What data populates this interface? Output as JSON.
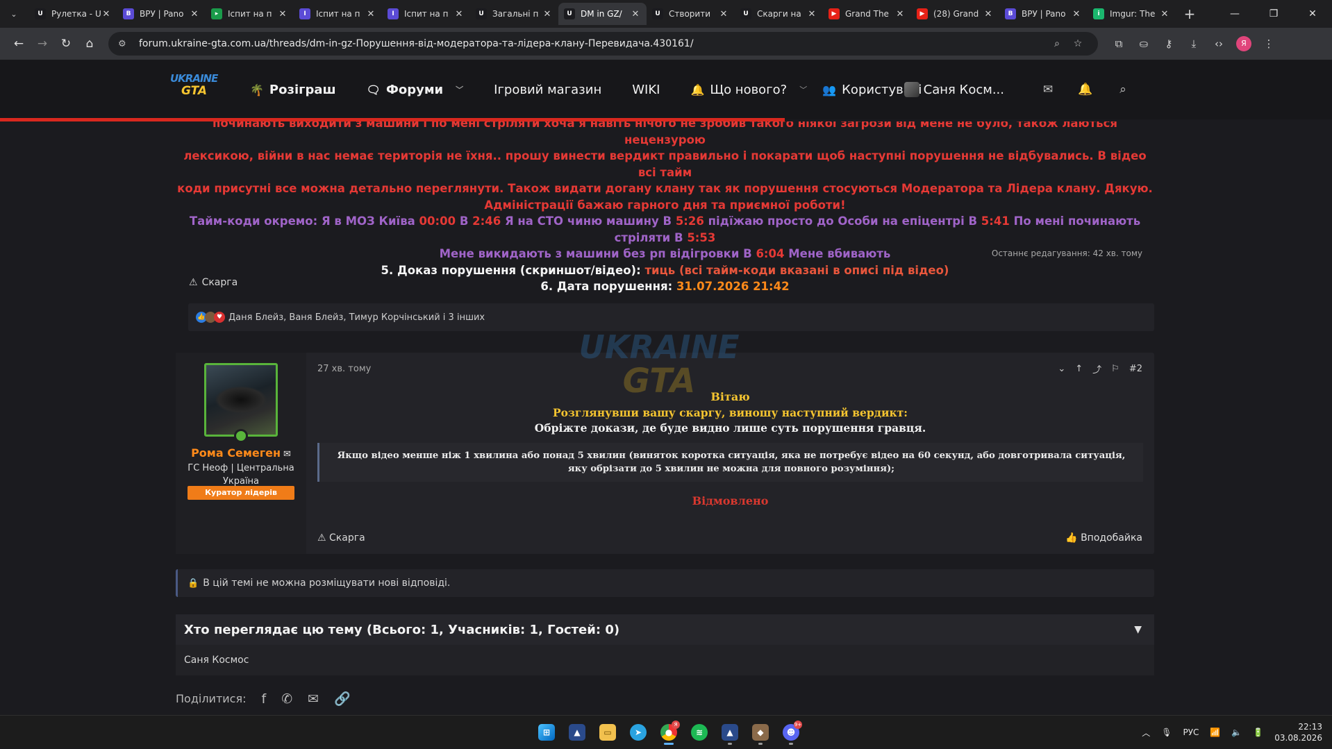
{
  "browser": {
    "tabs": [
      {
        "title": "Рулетка - U",
        "fav_color": "#1b1b1f",
        "fav": "U"
      },
      {
        "title": "ВРУ | Pano",
        "fav_color": "#5b4bd6",
        "fav": "В"
      },
      {
        "title": "Іспит на п",
        "fav_color": "#1a9b4a",
        "fav": "▸"
      },
      {
        "title": "Іспит на п",
        "fav_color": "#5b4bd6",
        "fav": "І"
      },
      {
        "title": "Іспит на п",
        "fav_color": "#5b4bd6",
        "fav": "І"
      },
      {
        "title": "Загальні п",
        "fav_color": "#1b1b1f",
        "fav": "U"
      },
      {
        "title": "DM in GZ/",
        "fav_color": "#1b1b1f",
        "fav": "U",
        "active": true
      },
      {
        "title": "Створити",
        "fav_color": "#1b1b1f",
        "fav": "U"
      },
      {
        "title": "Скарги на",
        "fav_color": "#1b1b1f",
        "fav": "U"
      },
      {
        "title": "Grand The",
        "fav_color": "#e62117",
        "fav": "▶"
      },
      {
        "title": "(28) Grand",
        "fav_color": "#e62117",
        "fav": "▶"
      },
      {
        "title": "ВРУ | Pano",
        "fav_color": "#5b4bd6",
        "fav": "В"
      },
      {
        "title": "Imgur: The",
        "fav_color": "#1bb76e",
        "fav": "i"
      }
    ],
    "url": "forum.ukraine-gta.com.ua/threads/dm-in-gz-Порушення-від-модератора-та-лідера-клану-Перевидача.430161/",
    "profile_initial": "Я"
  },
  "header": {
    "logo_top": "UKRAINE",
    "logo_bottom": "GTA",
    "nav": [
      {
        "label": "Розіграш",
        "icon": "palm-icon",
        "bold": true
      },
      {
        "label": "Форуми",
        "icon": "chat-icon",
        "bold": true,
        "dropdown": true
      },
      {
        "label": "Ігровий магазин"
      },
      {
        "label": "WIKI"
      },
      {
        "label": "Що нового?",
        "icon": "bell-icon",
        "dropdown": true
      },
      {
        "label": "Користувачі",
        "icon": "users-icon",
        "dropdown": true
      }
    ],
    "user": "Саня Косм..."
  },
  "post1": {
    "line1": "починають виходити з машини і по мені стріляти хоча я навіть нічого не зробив такого ніякої загрози від мене не було, також лаються нецензурою",
    "line2": "лексикою, війни в нас немає територія не їхня.. прошу винести вердикт правильно і покарати щоб наступні порушення не відбувались. В відео всі тайм",
    "line3": "коди присутні все можна детально переглянути. Також видати догану клану так як порушення стосуються Модератора та Лідера клану. Дякую.",
    "line4": "Адміністрації бажаю гарного дня та приємної роботи!",
    "tc_intro": "Тайм-коди окремо: Я в МОЗ Київа",
    "tc": [
      {
        "t": "00:00",
        "txt": "В"
      },
      {
        "t": "2:46",
        "txt": "Я на СТО чиню машину В"
      },
      {
        "t": "5:26",
        "txt": "підїжаю просто до Особи на епіцентрі В"
      },
      {
        "t": "5:41",
        "txt": "По мені починають стріляти В"
      },
      {
        "t": "5:53",
        "txt": ""
      }
    ],
    "tc2_intro": "Мене викидають з машини без рп відігровки В",
    "tc2_time": "6:04",
    "tc2_end": "Мене вбивають",
    "proof_label": "5. Доказ порушення (скриншот/відео):",
    "proof_value": "тиць (всі тайм-коди вказані в описі під відео)",
    "date_label": "6. Дата порушення:",
    "date_value": "31.07.2026 21:42",
    "edited": "Останнє редагування: 42 хв. тому",
    "complain": "Скарга",
    "reactions_text": "Даня Блейз, Ваня Блейз, Тимур Корчінський і 3 інших"
  },
  "post2": {
    "user_name": "Рома Семеген",
    "user_title": "ГС Неоф | Центральна Україна",
    "user_badge": "Куратор лідерів",
    "time": "27 хв. тому",
    "number": "#2",
    "watermark_top": "UKRAINE",
    "watermark_bottom": "GTA",
    "greeting": "Вітаю",
    "verdict_intro": "Розглянувши вашу скаргу, виношу наступний вердикт:",
    "verdict_text": "Обріжте докази, де буде видно лише суть порушення гравця.",
    "quote": "Якщо відео менше ніж 1 хвилина або понад 5 хвилин (виняток коротка ситуація, яка не потребує відео на 60 секунд, або довготривала ситуація, яку обрізати до 5 хвилин не можна для повного розуміння);",
    "status": "Відмовлено",
    "complain": "Скарга",
    "like": "Вподобайка"
  },
  "thread": {
    "locked": "В цій темі не можна розміщувати нові відповіді.",
    "viewers_title": "Хто переглядає цю тему (Всього: 1, Учасників: 1, Гостей: 0)",
    "viewers": "Саня Космос",
    "share": "Поділитися:"
  },
  "taskbar": {
    "lang": "РУС",
    "time": "22:13",
    "date": "03.08.2026"
  },
  "colors": {
    "accent_red": "#d9281e",
    "post_red": "#e53935",
    "post_purple": "#a064c8",
    "post_orange": "#ff8a1a",
    "greeting_yellow": "#f4c430",
    "badge_orange": "#f07c18"
  }
}
